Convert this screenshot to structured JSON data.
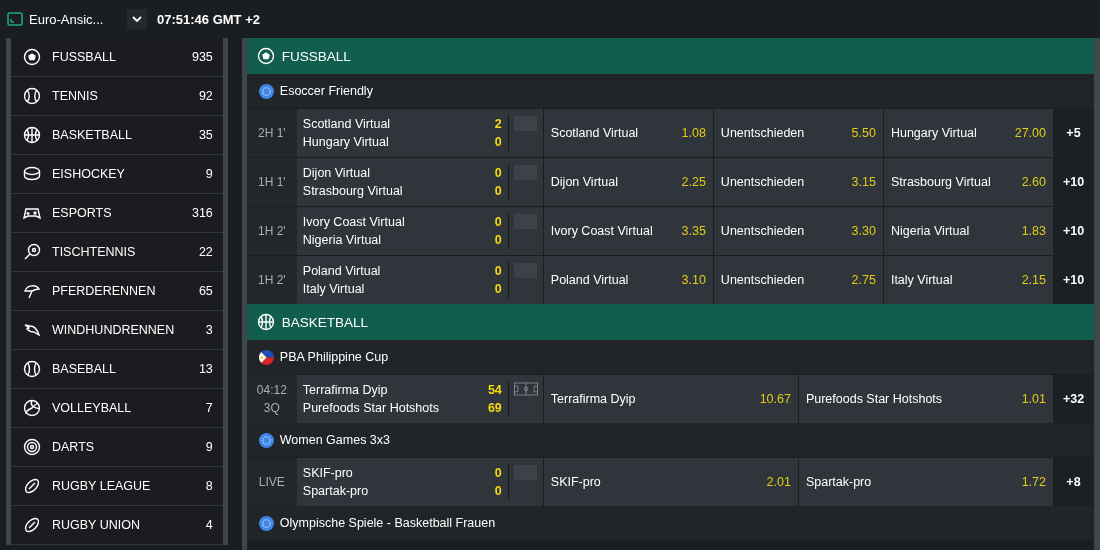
{
  "top_bar": {
    "view_label": "Euro-Ansic...",
    "clock": "07:51:46 GMT +2"
  },
  "sidebar": {
    "items": [
      {
        "label": "FUSSBALL",
        "count": "935"
      },
      {
        "label": "TENNIS",
        "count": "92"
      },
      {
        "label": "BASKETBALL",
        "count": "35"
      },
      {
        "label": "EISHOCKEY",
        "count": "9"
      },
      {
        "label": "ESPORTS",
        "count": "316"
      },
      {
        "label": "TISCHTENNIS",
        "count": "22"
      },
      {
        "label": "PFERDERENNEN",
        "count": "65"
      },
      {
        "label": "WINDHUNDRENNEN",
        "count": "3"
      },
      {
        "label": "BASEBALL",
        "count": "13"
      },
      {
        "label": "VOLLEYBALL",
        "count": "7"
      },
      {
        "label": "DARTS",
        "count": "9"
      },
      {
        "label": "RUGBY LEAGUE",
        "count": "8"
      },
      {
        "label": "RUGBY UNION",
        "count": "4"
      }
    ]
  },
  "sections": [
    {
      "title": "FUSSBALL",
      "leagues": [
        {
          "name": "Esoccer Friendly",
          "kind": "badge",
          "matches": [
            {
              "time": [
                "2H 1'"
              ],
              "kind": "blank",
              "teams": [
                {
                  "name": "Scotland Virtual",
                  "score": "2"
                },
                {
                  "name": "Hungary Virtual",
                  "score": "0"
                }
              ],
              "odds": [
                {
                  "label": "Scotland Virtual",
                  "price": "1.08"
                },
                {
                  "label": "Unentschieden",
                  "price": "5.50"
                },
                {
                  "label": "Hungary Virtual",
                  "price": "27.00"
                }
              ],
              "more": "+5"
            },
            {
              "time": [
                "1H 1'"
              ],
              "kind": "blank",
              "teams": [
                {
                  "name": "Dijon Virtual",
                  "score": "0"
                },
                {
                  "name": "Strasbourg Virtual",
                  "score": "0"
                }
              ],
              "odds": [
                {
                  "label": "Dijon Virtual",
                  "price": "2.25"
                },
                {
                  "label": "Unentschieden",
                  "price": "3.15"
                },
                {
                  "label": "Strasbourg Virtual",
                  "price": "2.60"
                }
              ],
              "more": "+10"
            },
            {
              "time": [
                "1H 2'"
              ],
              "kind": "blank",
              "teams": [
                {
                  "name": "Ivory Coast Virtual",
                  "score": "0"
                },
                {
                  "name": "Nigeria Virtual",
                  "score": "0"
                }
              ],
              "odds": [
                {
                  "label": "Ivory Coast Virtual",
                  "price": "3.35"
                },
                {
                  "label": "Unentschieden",
                  "price": "3.30"
                },
                {
                  "label": "Nigeria Virtual",
                  "price": "1.83"
                }
              ],
              "more": "+10"
            },
            {
              "time": [
                "1H 2'"
              ],
              "kind": "blank",
              "teams": [
                {
                  "name": "Poland Virtual",
                  "score": "0"
                },
                {
                  "name": "Italy Virtual",
                  "score": "0"
                }
              ],
              "odds": [
                {
                  "label": "Poland Virtual",
                  "price": "3.10"
                },
                {
                  "label": "Unentschieden",
                  "price": "2.75"
                },
                {
                  "label": "Italy Virtual",
                  "price": "2.15"
                }
              ],
              "more": "+10"
            }
          ]
        }
      ]
    },
    {
      "title": "BASKETBALL",
      "leagues": [
        {
          "name": "PBA Philippine Cup",
          "kind": "flag",
          "matches": [
            {
              "time": [
                "04:12",
                "3Q"
              ],
              "kind": "court",
              "teams": [
                {
                  "name": "Terrafirma Dyip",
                  "score": "54"
                },
                {
                  "name": "Purefoods Star Hotshots",
                  "score": "69"
                }
              ],
              "odds": [
                {
                  "label": "Terrafirma Dyip",
                  "price": "10.67"
                },
                {
                  "label": "Purefoods Star Hotshots",
                  "price": "1.01"
                }
              ],
              "more": "+32"
            }
          ]
        },
        {
          "name": "Women Games 3x3",
          "kind": "badge",
          "matches": [
            {
              "time": [
                "LIVE"
              ],
              "kind": "blank",
              "teams": [
                {
                  "name": "SKIF-pro",
                  "score": "0"
                },
                {
                  "name": "Spartak-pro",
                  "score": "0"
                }
              ],
              "odds": [
                {
                  "label": "SKIF-pro",
                  "price": "2.01"
                },
                {
                  "label": "Spartak-pro",
                  "price": "1.72"
                }
              ],
              "more": "+8"
            }
          ]
        },
        {
          "name": "Olympische Spiele - Basketball Frauen",
          "kind": "badge"
        }
      ]
    }
  ]
}
